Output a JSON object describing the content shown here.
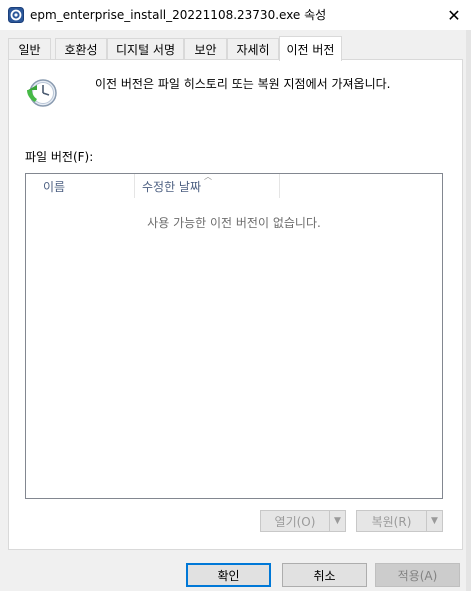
{
  "window": {
    "title": "epm_enterprise_install_20221108.23730.exe 속성",
    "close_glyph": "✕"
  },
  "tabs": [
    {
      "label": "일반",
      "active": false
    },
    {
      "label": "호환성",
      "active": false
    },
    {
      "label": "디지털 서명",
      "active": false
    },
    {
      "label": "보안",
      "active": false
    },
    {
      "label": "자세히",
      "active": false
    },
    {
      "label": "이전 버전",
      "active": true
    }
  ],
  "previous_versions": {
    "header_text": "이전 버전은 파일 히스토리 또는 복원 지점에서 가져옵니다.",
    "list_label": "파일 버전(F):",
    "columns": [
      "이름",
      "수정한 날짜"
    ],
    "empty_message": "사용 가능한 이전 버전이 없습니다.",
    "open_button": "열기(O)",
    "restore_button": "복원(R)"
  },
  "footer": {
    "ok": "확인",
    "cancel": "취소",
    "apply": "적용(A)"
  },
  "colors": {
    "accent": "#0078d7",
    "column_header_text": "#4d6082"
  },
  "icons": {
    "app": "app-icon",
    "header": "clock-restore-icon"
  }
}
